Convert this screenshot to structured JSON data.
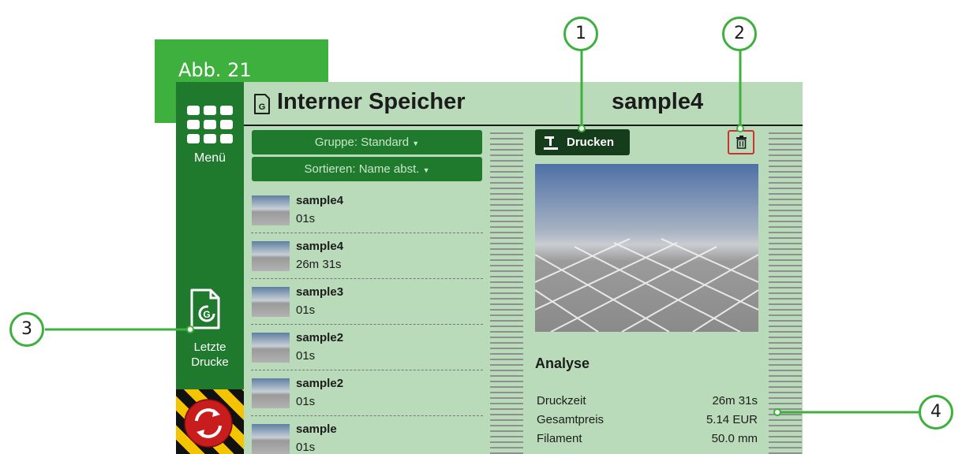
{
  "figure_label": "Abb. 21",
  "sidebar": {
    "menu_label": "Menü",
    "menu_icon": "grid-icon",
    "recent_label_line1": "Letzte",
    "recent_label_line2": "Drucke",
    "recent_icon": "gcode-file-icon",
    "stop_icon": "emergency-stop-icon"
  },
  "header": {
    "title": "Interner Speicher",
    "title_icon": "gcode-file-icon",
    "selected_file": "sample4"
  },
  "file_list": {
    "group_button": "Gruppe: Standard",
    "sort_button": "Sortieren: Name abst.",
    "items": [
      {
        "name": "sample4",
        "time": "01s"
      },
      {
        "name": "sample4",
        "time": "26m 31s"
      },
      {
        "name": "sample3",
        "time": "01s"
      },
      {
        "name": "sample2",
        "time": "01s"
      },
      {
        "name": "sample2",
        "time": "01s"
      },
      {
        "name": "sample",
        "time": "01s"
      }
    ]
  },
  "detail": {
    "print_button": "Drucken",
    "print_icon": "print-icon",
    "delete_icon": "trash-icon",
    "analysis_title": "Analyse",
    "stats": [
      {
        "label": "Druckzeit",
        "value": "26m 31s"
      },
      {
        "label": "Gesamtpreis",
        "value": "5.14 EUR"
      },
      {
        "label": "Filament",
        "value": "50.0 mm"
      }
    ]
  },
  "callouts": [
    "1",
    "2",
    "3",
    "4"
  ],
  "colors": {
    "accent_green": "#3db03d",
    "sidebar_green": "#1f7a2e",
    "screen_bg": "#b9dbb9",
    "delete_red": "#c83434"
  }
}
